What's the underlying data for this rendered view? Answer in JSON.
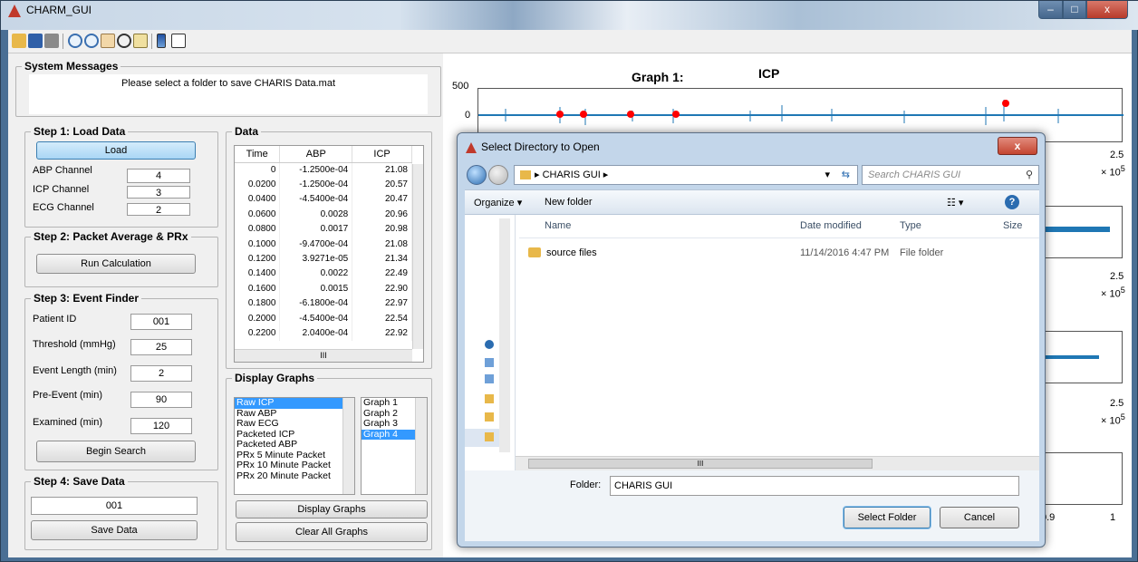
{
  "window": {
    "title": "CHARM_GUI",
    "min": "–",
    "max": "□",
    "close": "x"
  },
  "toolbar": {
    "icons": [
      "open-folder-icon",
      "save-icon",
      "print-icon",
      "zoom-in-icon",
      "zoom-out-icon",
      "pan-icon",
      "rotate-icon",
      "datacursor-icon",
      "colorbar-icon",
      "legend-icon"
    ]
  },
  "system_messages": {
    "title": "System Messages",
    "text": "Please select a folder to save CHARIS Data.mat"
  },
  "step1": {
    "title": "Step 1: Load Data",
    "load_label": "Load",
    "abp_label": "ABP Channel",
    "abp_value": "4",
    "icp_label": "ICP Channel",
    "icp_value": "3",
    "ecg_label": "ECG Channel",
    "ecg_value": "2"
  },
  "step2": {
    "title": "Step 2: Packet Average & PRx",
    "run_label": "Run Calculation"
  },
  "step3": {
    "title": "Step 3: Event Finder",
    "patient_label": "Patient ID",
    "patient_value": "001",
    "threshold_label": "Threshold (mmHg)",
    "threshold_value": "25",
    "length_label": "Event Length (min)",
    "length_value": "2",
    "pre_label": "Pre-Event (min)",
    "pre_value": "90",
    "examined_label": "Examined (min)",
    "examined_value": "120",
    "search_label": "Begin Search"
  },
  "step4": {
    "title": "Step 4: Save Data",
    "value": "001",
    "save_label": "Save Data"
  },
  "data": {
    "title": "Data",
    "columns": [
      "Time",
      "ABP",
      "ICP"
    ],
    "rows": [
      [
        "0",
        "-1.2500e-04",
        "21.08"
      ],
      [
        "0.0200",
        "-1.2500e-04",
        "20.57"
      ],
      [
        "0.0400",
        "-4.5400e-04",
        "20.47"
      ],
      [
        "0.0600",
        "0.0028",
        "20.96"
      ],
      [
        "0.0800",
        "0.0017",
        "20.98"
      ],
      [
        "0.1000",
        "-9.4700e-04",
        "21.08"
      ],
      [
        "0.1200",
        "3.9271e-05",
        "21.34"
      ],
      [
        "0.1400",
        "0.0022",
        "22.49"
      ],
      [
        "0.1600",
        "0.0015",
        "22.90"
      ],
      [
        "0.1800",
        "-6.1800e-04",
        "22.97"
      ],
      [
        "0.2000",
        "-4.5400e-04",
        "22.54"
      ],
      [
        "0.2200",
        "2.0400e-04",
        "22.92"
      ]
    ],
    "hscroll_mark": "III"
  },
  "display": {
    "title": "Display Graphs",
    "signals": [
      "Raw ICP",
      "Raw ABP",
      "Raw ECG",
      "Packeted ICP",
      "Packeted ABP",
      "PRx 5 Minute Packet",
      "PRx 10 Minute Packet",
      "PRx 20 Minute Packet"
    ],
    "graphs": [
      "Graph 1",
      "Graph 2",
      "Graph 3",
      "Graph 4"
    ],
    "display_label": "Display Graphs",
    "clear_label": "Clear All Graphs"
  },
  "plot": {
    "graph_label": "Graph 1:",
    "graph_title": "ICP",
    "y_ticks": [
      "500",
      "0"
    ],
    "x_end_label": "2.5",
    "x_exp_label": "× 10",
    "x_exp_power": "5",
    "bottom_ticks": [
      "0.9",
      "1"
    ]
  },
  "dialog": {
    "title": "Select Directory to Open",
    "close": "x",
    "path": "▸ CHARIS GUI ▸",
    "search_placeholder": "Search CHARIS GUI",
    "organize": "Organize ▾",
    "new_folder": "New folder",
    "columns": [
      "Name",
      "Date modified",
      "Type",
      "Size"
    ],
    "file": {
      "name": "source files",
      "date": "11/14/2016 4:47 PM",
      "type": "File folder"
    },
    "hscroll_mark": "III",
    "folder_label": "Folder:",
    "folder_value": "CHARIS GUI",
    "select_label": "Select Folder",
    "cancel_label": "Cancel"
  },
  "colors": {
    "accent": "#3399ff",
    "trace": "#1f77b4",
    "marker": "#ff0000"
  }
}
